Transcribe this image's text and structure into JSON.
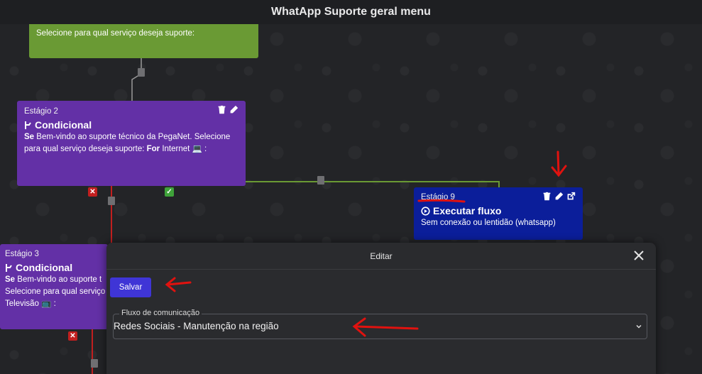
{
  "window": {
    "title": "WhatApp Suporte geral menu"
  },
  "nodes": {
    "green": {
      "text": "Selecione para qual serviço deseja suporte:"
    },
    "stage2": {
      "stage_label": "Estágio 2",
      "type_label": "Condicional",
      "text_prefix": "Se",
      "text_body": "Bem-vindo ao suporte técnico da PegaNet. Selecione para qual serviço deseja suporte:",
      "text_bold": "For",
      "text_tail": "Internet 💻 :"
    },
    "stage3": {
      "stage_label": "Estágio 3",
      "type_label": "Condicional",
      "text_prefix": "Se",
      "line1": "Bem-vindo ao suporte t",
      "line2": "Selecione para qual serviço",
      "line3": "Televisão 📺 :"
    },
    "stage9": {
      "stage_label": "Estágio 9",
      "type_label": "Executar fluxo",
      "text": "Sem conexão ou lentidão (whatsapp)"
    }
  },
  "modal": {
    "title": "Editar",
    "save_label": "Salvar",
    "flow_field": {
      "label": "Fluxo de comunicação",
      "value": "Redes Sociais - Manutenção na região"
    }
  },
  "colors": {
    "condition_node": "#6330a6",
    "flow_node": "#0b1e9a",
    "message_node": "#6a9a34",
    "save_button": "#3f35d6",
    "annotation": "#e0120f"
  }
}
